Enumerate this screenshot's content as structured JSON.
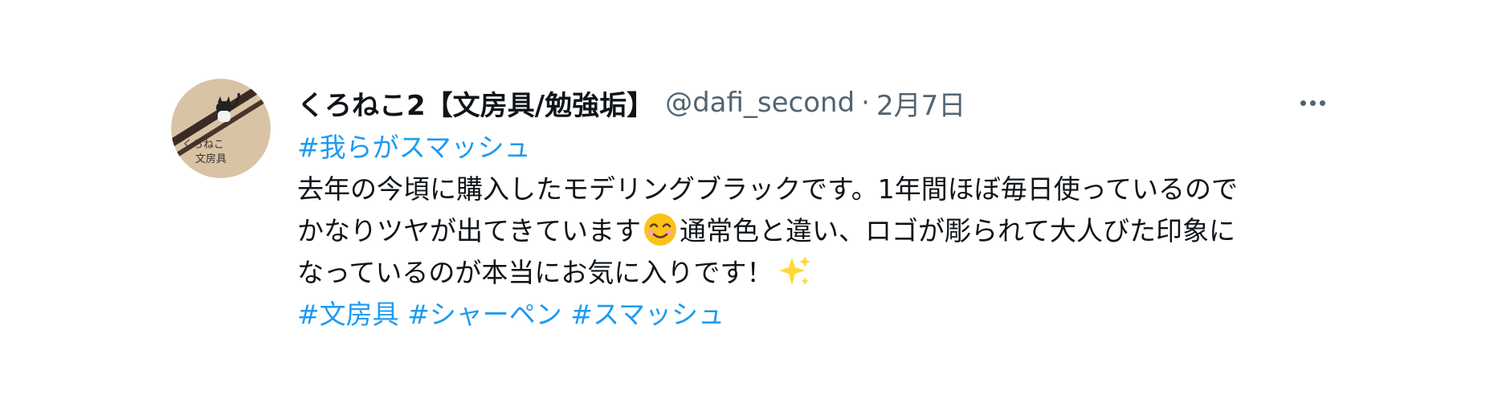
{
  "tweet": {
    "display_name": "くろねこ2【文房具/勉強垢】",
    "handle": "@dafi_second",
    "separator": "·",
    "date": "2月7日",
    "avatar_text_line1": "くろねこ",
    "avatar_text_line2": "文房具",
    "hashtag_top": "#我らがスマッシュ",
    "text_line1": "去年の今頃に購入したモデリングブラックです。1年間ほぼ毎日使っているので",
    "text_line2_a": "かなりツヤが出てきています",
    "text_line2_b": "通常色と違い、ロゴが彫られて大人びた印象に",
    "text_line3": "なっているのが本当にお気に入りです！",
    "hashtags_bottom": [
      "#文房具",
      "#シャーペン",
      "#スマッシュ"
    ],
    "emojis": [
      "smiling-face-icon",
      "sparkles-icon"
    ]
  },
  "colors": {
    "text": "#0f1419",
    "secondary": "#536471",
    "link": "#1d9bf0"
  }
}
